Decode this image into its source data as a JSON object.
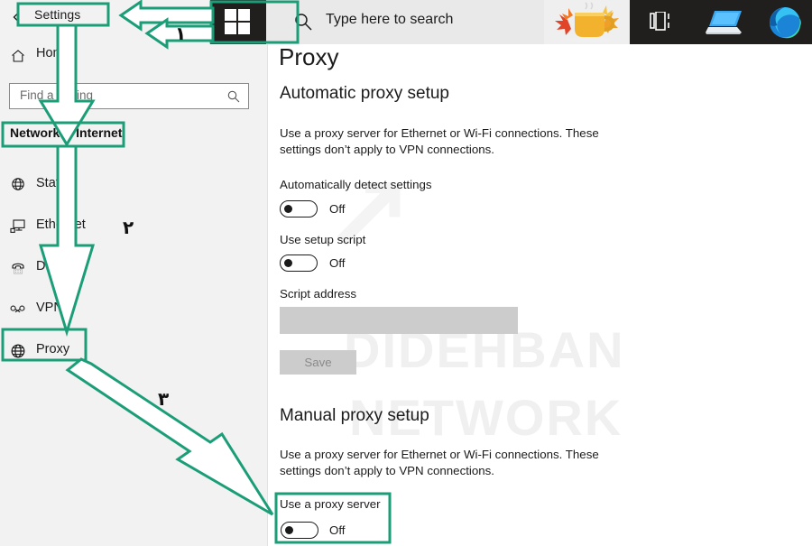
{
  "window": {
    "app_title": "Settings",
    "back_icon": "back-arrow-icon",
    "home_label": "Home",
    "home_icon": "home-icon"
  },
  "search": {
    "placeholder": "Find a setting",
    "value": "",
    "icon": "search-icon"
  },
  "sidebar": {
    "category": "Network & Internet",
    "items": [
      {
        "label": "Status",
        "icon": "globe-icon",
        "selected": false
      },
      {
        "label": "Ethernet",
        "icon": "monitor-icon",
        "selected": false
      },
      {
        "label": "Dial-up",
        "icon": "telephone-icon",
        "selected": false
      },
      {
        "label": "VPN",
        "icon": "vpn-key-icon",
        "selected": false
      },
      {
        "label": "Proxy",
        "icon": "globe-icon",
        "selected": true
      }
    ]
  },
  "main": {
    "title": "Proxy",
    "automatic": {
      "heading": "Automatic proxy setup",
      "description": "Use a proxy server for Ethernet or Wi-Fi connections. These settings don’t apply to VPN connections.",
      "auto_detect_label": "Automatically detect settings",
      "auto_detect_state": "Off",
      "setup_script_label": "Use setup script",
      "setup_script_state": "Off",
      "script_address_label": "Script address",
      "script_address_value": "",
      "save_label": "Save"
    },
    "manual": {
      "heading": "Manual proxy setup",
      "description": "Use a proxy server for Ethernet or Wi-Fi connections. These settings don’t apply to VPN connections.",
      "use_proxy_label": "Use a proxy server",
      "use_proxy_state": "Off"
    }
  },
  "watermark": {
    "logo": "↗",
    "line1": "DIDEHBAN",
    "line2": "NETWORK"
  },
  "taskbar": {
    "start_icon": "windows-start-icon",
    "search_icon": "search-icon",
    "search_placeholder": "Type here to search",
    "cortana_icon": "coffee-mug-icon",
    "taskview_icon": "task-view-icon",
    "app1_icon": "laptop-icon",
    "app2_icon": "edge-browser-icon"
  },
  "annotations": {
    "accent_color": "#1b9e77",
    "step1": "۱",
    "step2": "۲",
    "step3": "۳",
    "highlight_settings": "Settings",
    "highlight_category": "Network & Internet",
    "highlight_proxy": "Proxy",
    "highlight_use_proxy": "Use a proxy server"
  }
}
